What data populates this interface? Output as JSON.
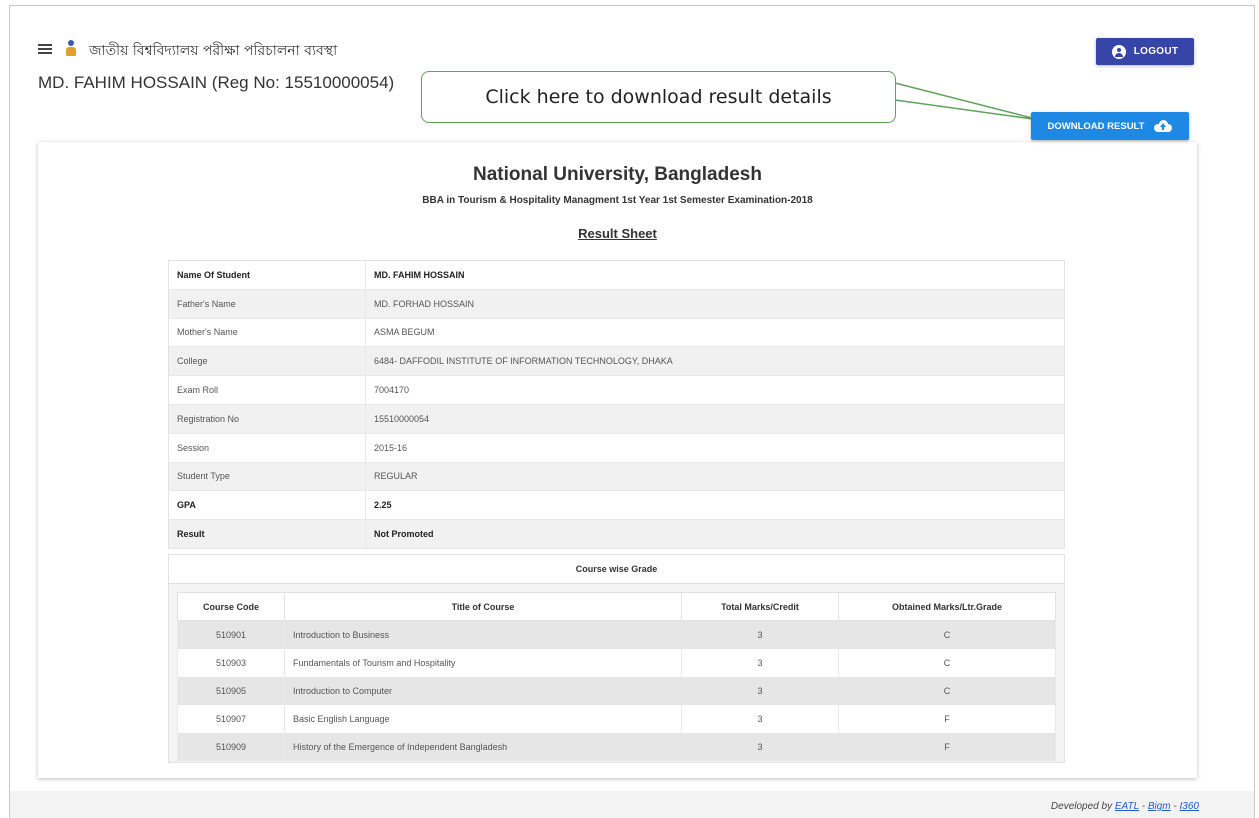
{
  "header": {
    "app_title": "জাতীয় বিশ্ববিদ্যালয় পরীক্ষা পরিচালনা ব্যবস্থা",
    "student_heading": "MD. FAHIM HOSSAIN (Reg No: 15510000054)",
    "logout_label": "LOGOUT",
    "download_label": "DOWNLOAD RESULT"
  },
  "callout": {
    "text": "Click here to download result details"
  },
  "result": {
    "university": "National University, Bangladesh",
    "exam": "BBA in Tourism & Hospitality Managment 1st Year 1st Semester Examination-2018",
    "sheet_title": "Result Sheet",
    "info": [
      {
        "label": "Name Of Student",
        "value": "MD. FAHIM HOSSAIN"
      },
      {
        "label": "Father's Name",
        "value": "MD. FORHAD HOSSAIN"
      },
      {
        "label": "Mother's Name",
        "value": "ASMA BEGUM"
      },
      {
        "label": "College",
        "value": "6484- DAFFODIL INSTITUTE OF INFORMATION TECHNOLOGY, DHAKA"
      },
      {
        "label": "Exam Roll",
        "value": "7004170"
      },
      {
        "label": "Registration No",
        "value": "15510000054"
      },
      {
        "label": "Session",
        "value": "2015-16"
      },
      {
        "label": "Student Type",
        "value": "REGULAR"
      },
      {
        "label": "GPA",
        "value": "2.25"
      },
      {
        "label": "Result",
        "value": "Not Promoted"
      }
    ],
    "course_caption": "Course wise Grade",
    "course_headers": [
      "Course Code",
      "Title of Course",
      "Total Marks/Credit",
      "Obtained Marks/Ltr.Grade"
    ],
    "courses": [
      {
        "code": "510901",
        "title": "Introduction to Business",
        "credit": "3",
        "grade": "C"
      },
      {
        "code": "510903",
        "title": "Fundamentals of Tourism and Hospitality",
        "credit": "3",
        "grade": "C"
      },
      {
        "code": "510905",
        "title": "Introduction to Computer",
        "credit": "3",
        "grade": "C"
      },
      {
        "code": "510907",
        "title": "Basic English Language",
        "credit": "3",
        "grade": "F"
      },
      {
        "code": "510909",
        "title": "History of the Emergence of Independent Bangladesh",
        "credit": "3",
        "grade": "F"
      }
    ]
  },
  "footer": {
    "prefix": "Developed by ",
    "links": [
      "EATL",
      "Bigm",
      "I360"
    ],
    "separator": " - "
  },
  "colors": {
    "logout_bg": "#3645a7",
    "download_bg": "#1e88e5",
    "callout_border": "#5ea35a"
  }
}
